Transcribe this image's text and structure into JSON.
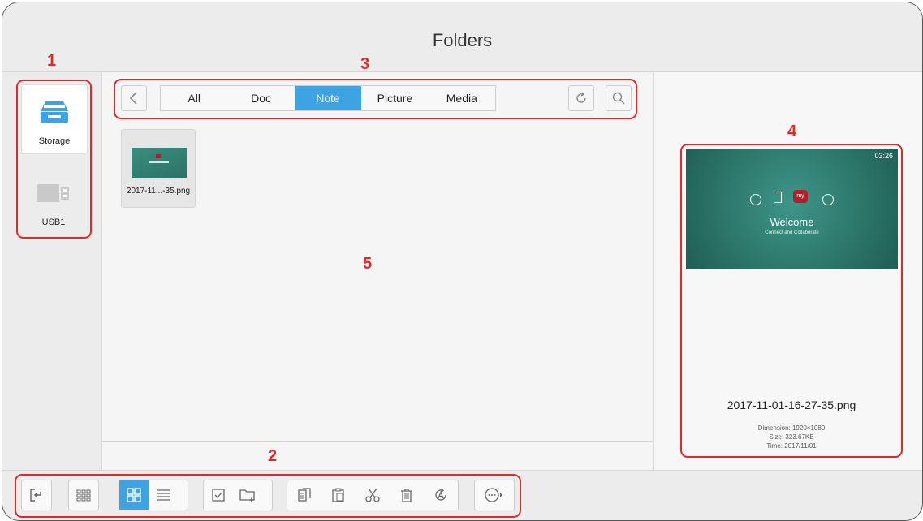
{
  "title": "Folders",
  "sidebar": {
    "items": [
      {
        "label": "Storage",
        "icon": "storage-drive-icon",
        "selected": true
      },
      {
        "label": "USB1",
        "icon": "usb-drive-icon",
        "selected": false
      }
    ]
  },
  "filter_tabs": [
    {
      "label": "All",
      "active": false
    },
    {
      "label": "Doc",
      "active": false
    },
    {
      "label": "Note",
      "active": true
    },
    {
      "label": "Picture",
      "active": false
    },
    {
      "label": "Media",
      "active": false
    }
  ],
  "files": [
    {
      "name": "2017-11...-35.png"
    }
  ],
  "preview": {
    "image": {
      "clock": "03:26",
      "welcome": "Welcome",
      "subtitle": "Connect and Collaborate",
      "app_label": "my"
    },
    "filename": "2017-11-01-16-27-35.png",
    "dimension": "Dimension: 1920×1080",
    "size": "Size: 323.67KB",
    "time": "Time: 2017/11/01"
  },
  "annotations": [
    "1",
    "2",
    "3",
    "4",
    "5"
  ],
  "colors": {
    "accent": "#3ea3e2",
    "annotation": "#e02a2a"
  },
  "toolbar_icons": [
    "exit-icon",
    "apps-grid-icon",
    "grid-view-icon",
    "list-view-icon",
    "select-checkbox-icon",
    "new-folder-icon",
    "copy-icon",
    "paste-icon",
    "cut-icon",
    "delete-icon",
    "rename-icon",
    "more-icon"
  ]
}
